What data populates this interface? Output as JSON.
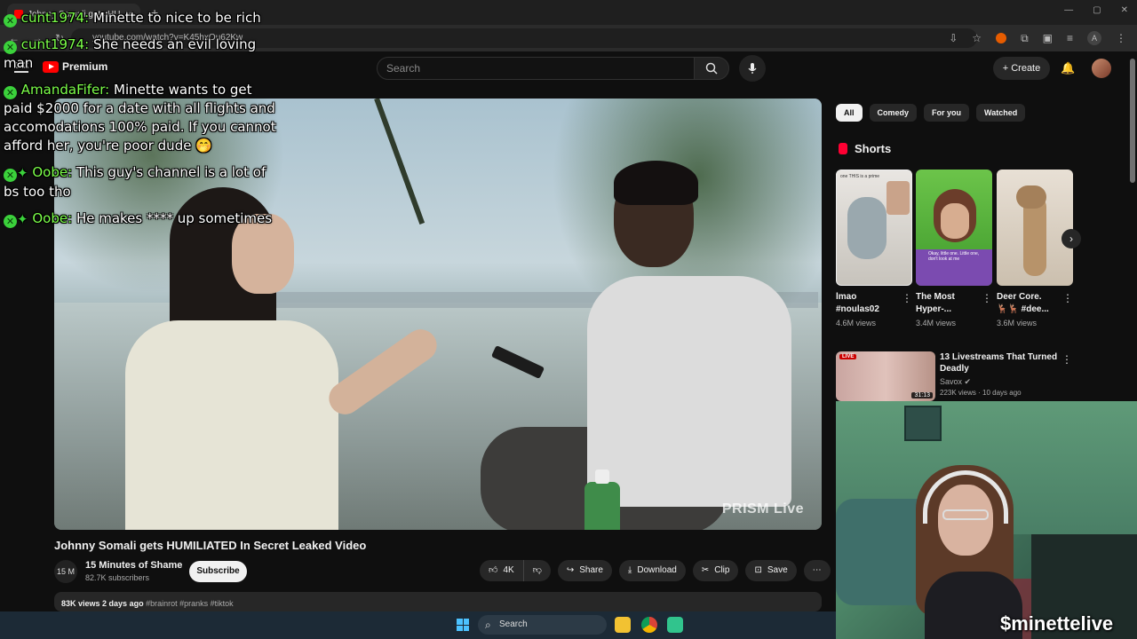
{
  "browser": {
    "tab_title": "Johnny Somali gets HUMILI",
    "tab_close": "✕",
    "new_tab": "+",
    "url": "youtube.com/watch?v=K45hxOu62Kw",
    "profile_letter": "A",
    "window_controls": [
      "—",
      "▢",
      "✕"
    ]
  },
  "youtube": {
    "logo_text": "Premium",
    "search_placeholder": "Search",
    "create_label": "Create"
  },
  "video": {
    "watermark": "PRISM Live",
    "title": "Johnny Somali gets HUMILIATED In Secret Leaked Video",
    "channel_avatar": "15 M",
    "channel_name": "15 Minutes of Shame",
    "subscribers": "82.7K subscribers",
    "subscribe_label": "Subscribe",
    "likes": "4K",
    "share_label": "Share",
    "download_label": "Download",
    "clip_label": "Clip",
    "save_label": "Save",
    "more_label": "⋯",
    "views": "83K views",
    "date": "2 days ago",
    "tags": "#brainrot #pranks #tiktok"
  },
  "filters": {
    "chips": [
      "All",
      "Comedy",
      "For you",
      "Watched"
    ]
  },
  "shorts": {
    "heading": "Shorts",
    "items": [
      {
        "title_line1": "lmao",
        "title_line2": "#noulas02",
        "views": "4.6M views",
        "thumb_text": "one THIS is a prime"
      },
      {
        "title_line1": "The Most",
        "title_line2": "Hyper-...",
        "views": "3.4M views",
        "thumb_text": "Okay, little one. Little one, don't look at me"
      },
      {
        "title_line1": "Deer Core.",
        "title_line2": "🦌🦌 #dee...",
        "views": "3.6M views",
        "thumb_text": ""
      }
    ]
  },
  "recommended": {
    "badge": "LIVE",
    "title": "13 Livestreams That Turned Deadly",
    "channel": "Savox",
    "meta": "223K views · 10 days ago",
    "duration": "31:13"
  },
  "webcam": {
    "streamer_name": "$minettelive"
  },
  "taskbar": {
    "search_label": "Search"
  },
  "chat": [
    {
      "user": "cunt1974:",
      "text": "Minette to nice to be rich",
      "badges": 1
    },
    {
      "user": "cunt1974:",
      "text": "She needs an evil loving man",
      "badges": 1
    },
    {
      "user": "AmandaFifer:",
      "text": "Minette wants to get paid $2000 for a date with all flights and accomodations 100% paid. If you cannot afford her, you're poor dude 🤭",
      "badges": 1
    },
    {
      "user": "Oobe:",
      "text": "This guy's channel is a lot of bs too tho",
      "badges": 2
    },
    {
      "user": "Oobe:",
      "text": "He makes **** up sometimes",
      "badges": 2
    }
  ]
}
